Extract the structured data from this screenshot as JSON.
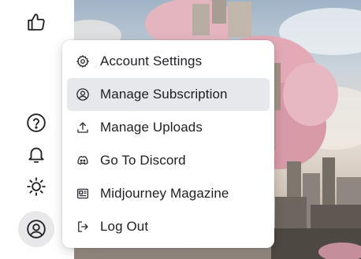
{
  "sidebar": {
    "icons": [
      {
        "name": "thumbs-up-icon"
      },
      {
        "name": "help-icon"
      },
      {
        "name": "bell-icon"
      },
      {
        "name": "sun-icon"
      },
      {
        "name": "user-avatar-icon"
      }
    ]
  },
  "menu": {
    "items": [
      {
        "label": "Account Settings",
        "icon": "gear-icon",
        "active": false
      },
      {
        "label": "Manage Subscription",
        "icon": "user-circle-icon",
        "active": true
      },
      {
        "label": "Manage Uploads",
        "icon": "upload-icon",
        "active": false
      },
      {
        "label": "Go To Discord",
        "icon": "discord-icon",
        "active": false
      },
      {
        "label": "Midjourney Magazine",
        "icon": "magazine-icon",
        "active": false
      },
      {
        "label": "Log Out",
        "icon": "logout-icon",
        "active": false
      }
    ]
  },
  "colors": {
    "menu_hover": "#e7e8ec",
    "text": "#1e1f24",
    "icon": "#2b2c33"
  }
}
